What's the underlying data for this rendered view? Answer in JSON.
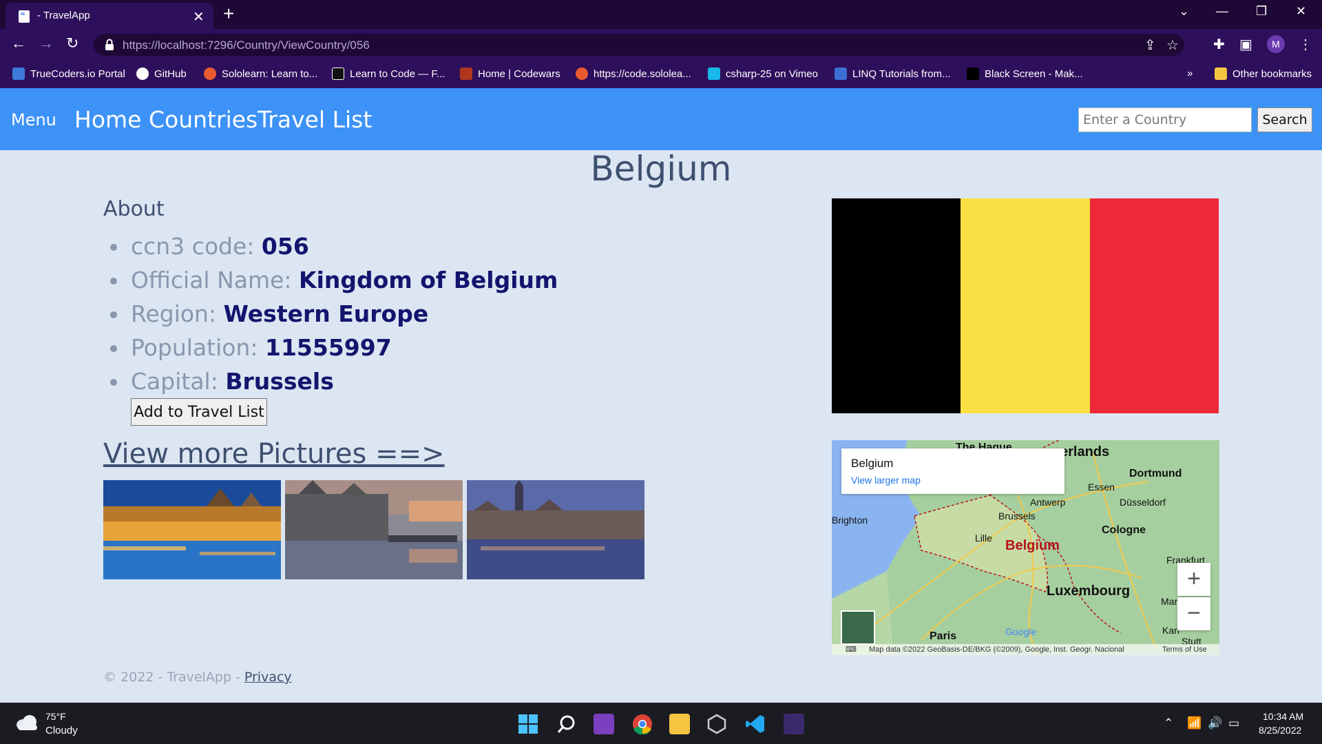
{
  "browser": {
    "tab_title": "- TravelApp",
    "tab_close": "✕",
    "new_tab": "+",
    "url_host": "https://localhost",
    "url_path": ":7296/Country/ViewCountry/056",
    "avatar_letter": "M",
    "bookmarks": [
      {
        "label": "TrueCoders.io Portal",
        "color": "#3d7bd9"
      },
      {
        "label": "GitHub",
        "color": "#ffffff"
      },
      {
        "label": "Sololearn: Learn to...",
        "color": "#e95b2f"
      },
      {
        "label": "Learn to Code — F...",
        "color": "#111111"
      },
      {
        "label": "Home | Codewars",
        "color": "#b1361e"
      },
      {
        "label": "https://code.sololea...",
        "color": "#e95b2f"
      },
      {
        "label": "csharp-25 on Vimeo",
        "color": "#1ab7ea"
      },
      {
        "label": "LINQ Tutorials from...",
        "color": "#3b6fd4"
      },
      {
        "label": "Black Screen - Mak...",
        "color": "#000000"
      }
    ],
    "more_bookmarks": "»",
    "other_bookmarks": "Other bookmarks"
  },
  "nav": {
    "menu": "Menu",
    "links": [
      "Home",
      "Countries",
      "Travel List"
    ],
    "search_placeholder": "Enter a Country",
    "search_button": "Search"
  },
  "country": {
    "name": "Belgium",
    "about_heading": "About",
    "facts": [
      {
        "label": "ccn3 code: ",
        "value": "056"
      },
      {
        "label": "Official Name: ",
        "value": "Kingdom of Belgium"
      },
      {
        "label": "Region: ",
        "value": "Western Europe"
      },
      {
        "label": "Population: ",
        "value": "11555997"
      },
      {
        "label": "Capital: ",
        "value": "Brussels"
      }
    ],
    "add_button": "Add to Travel List",
    "more_pictures": "View more Pictures ==>",
    "flag_colors": [
      "#000000",
      "#fae042",
      "#ed2939"
    ]
  },
  "map": {
    "card_title": "Belgium",
    "card_link": "View larger map",
    "labels": {
      "hague": "The Hague",
      "nl": "erlands",
      "dortmund": "Dortmund",
      "essen": "Essen",
      "antwerp": "Antwerp",
      "dusseldorf": "Düsseldorf",
      "brussels": "Brussels",
      "brighton": "Brighton",
      "cologne": "Cologne",
      "lille": "Lille",
      "belgium": "Belgium",
      "frankfurt": "Frankfurt",
      "luxembourg": "Luxembourg",
      "paris": "Paris",
      "google": "Google",
      "karl": "Karl",
      "stutt": "Stutt",
      "mar": "Mar"
    },
    "zoom_in": "+",
    "zoom_out": "−",
    "attribution": "Map data ©2022 GeoBasis-DE/BKG (©2009), Google, Inst. Geogr. Nacional",
    "terms": "Terms of Use"
  },
  "footer": {
    "text": "© 2022 - TravelApp - ",
    "privacy": "Privacy"
  },
  "taskbar": {
    "temp": "75°F",
    "condition": "Cloudy",
    "time": "10:34 AM",
    "date": "8/25/2022"
  }
}
